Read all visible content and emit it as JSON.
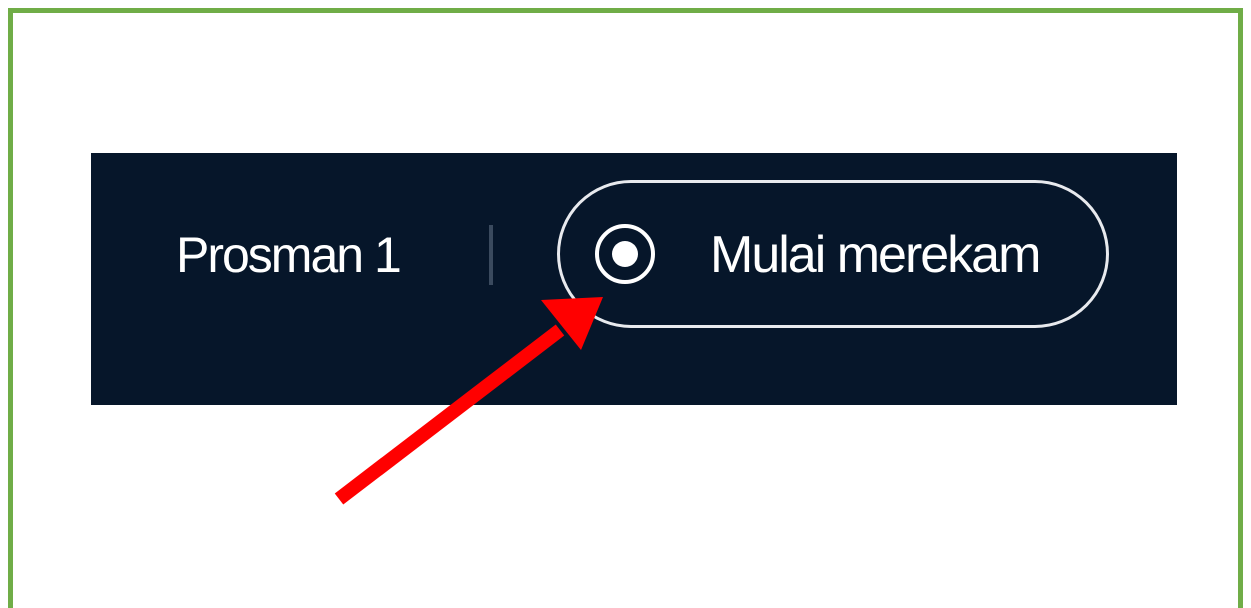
{
  "toolbar": {
    "meeting_title": "Prosman 1",
    "record_button_label": "Mulai merekam",
    "record_icon": "record-icon",
    "background_color": "#06162a"
  },
  "annotation": {
    "frame_color": "#70ad47",
    "arrow_color": "#ff0000"
  }
}
